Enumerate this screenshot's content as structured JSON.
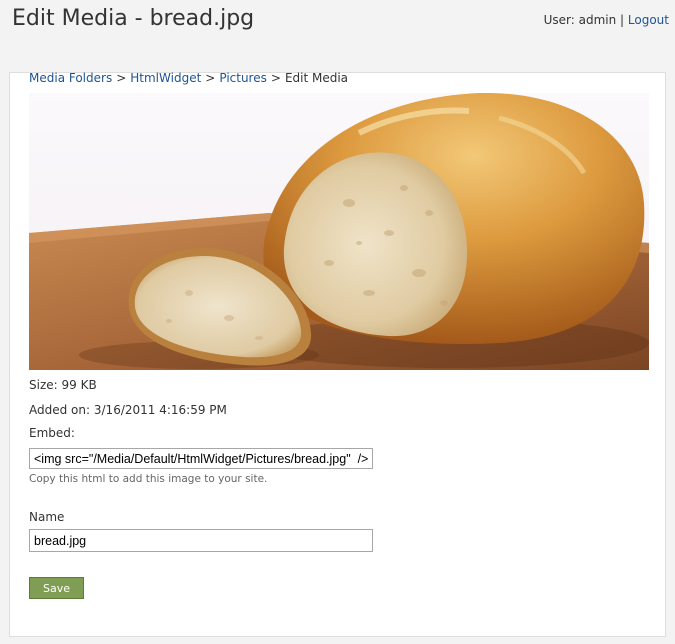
{
  "header": {
    "title": "Edit Media - bread.jpg",
    "user_prefix": "User:",
    "user_name": "admin",
    "separator": "|",
    "logout_label": "Logout"
  },
  "breadcrumb": {
    "items": [
      "Media Folders",
      "HtmlWidget",
      "Pictures"
    ],
    "current": "Edit Media",
    "separator": ">"
  },
  "media": {
    "size_label": "Size:",
    "size_value": "99 KB",
    "added_label": "Added on:",
    "added_value": "3/16/2011 4:16:59 PM",
    "embed_label": "Embed:",
    "embed_value": "<img src=\"/Media/Default/HtmlWidget/Pictures/bread.jpg\"  />",
    "embed_hint": "Copy this html to add this image to your site.",
    "name_label": "Name",
    "name_value": "bread.jpg"
  },
  "actions": {
    "save_label": "Save"
  },
  "colors": {
    "link": "#1e5494",
    "save_button": "#7f9e54",
    "page_background": "#f3f3f3"
  }
}
